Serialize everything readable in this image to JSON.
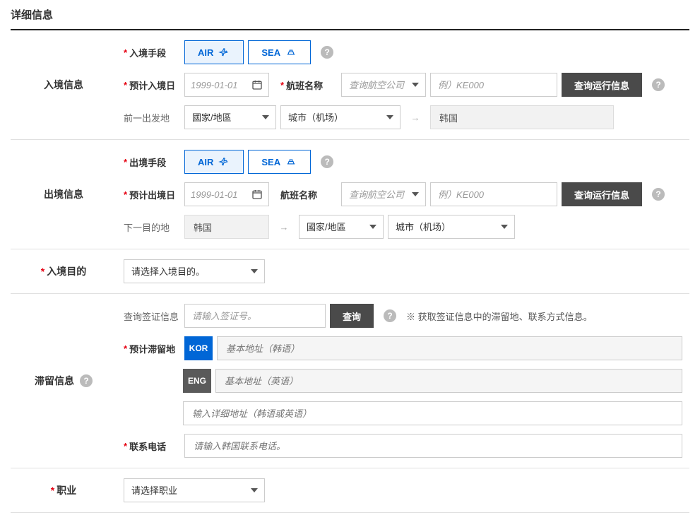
{
  "page_title": "详细信息",
  "entry": {
    "section_label": "入境信息",
    "method_label": "入境手段",
    "air": "AIR",
    "sea": "SEA",
    "date_label": "预计入境日",
    "date_value": "1999-01-01",
    "flight_label": "航班名称",
    "airline_placeholder": "查询航空公司",
    "flight_placeholder": "例）KE000",
    "query_btn": "查询运行信息",
    "prev_dep_label": "前一出发地",
    "country_placeholder": "國家/地區",
    "city_placeholder": "城市（机场）",
    "dest_fixed": "韩国"
  },
  "exit": {
    "section_label": "出境信息",
    "method_label": "出境手段",
    "air": "AIR",
    "sea": "SEA",
    "date_label": "预计出境日",
    "date_value": "1999-01-01",
    "flight_label": "航班名称",
    "airline_placeholder": "查询航空公司",
    "flight_placeholder": "例）KE000",
    "query_btn": "查询运行信息",
    "next_dest_label": "下一目的地",
    "origin_fixed": "韩国",
    "country_placeholder": "國家/地區",
    "city_placeholder": "城市（机场）"
  },
  "purpose": {
    "section_label": "入境目的",
    "placeholder": "请选择入境目的。"
  },
  "stay": {
    "section_label": "滞留信息",
    "visa_label": "查询签证信息",
    "visa_placeholder": "请输入签证号。",
    "visa_btn": "查询",
    "visa_note": "※ 获取签证信息中的滞留地、联系方式信息。",
    "addr_label": "预计滞留地",
    "kor_badge": "KOR",
    "kor_placeholder": "基本地址（韩语）",
    "eng_badge": "ENG",
    "eng_placeholder": "基本地址（英语）",
    "detail_placeholder": "输入详细地址（韩语或英语）",
    "phone_label": "联系电话",
    "phone_placeholder": "请输入韩国联系电话。"
  },
  "occupation": {
    "section_label": "职业",
    "placeholder": "请选择职业"
  }
}
